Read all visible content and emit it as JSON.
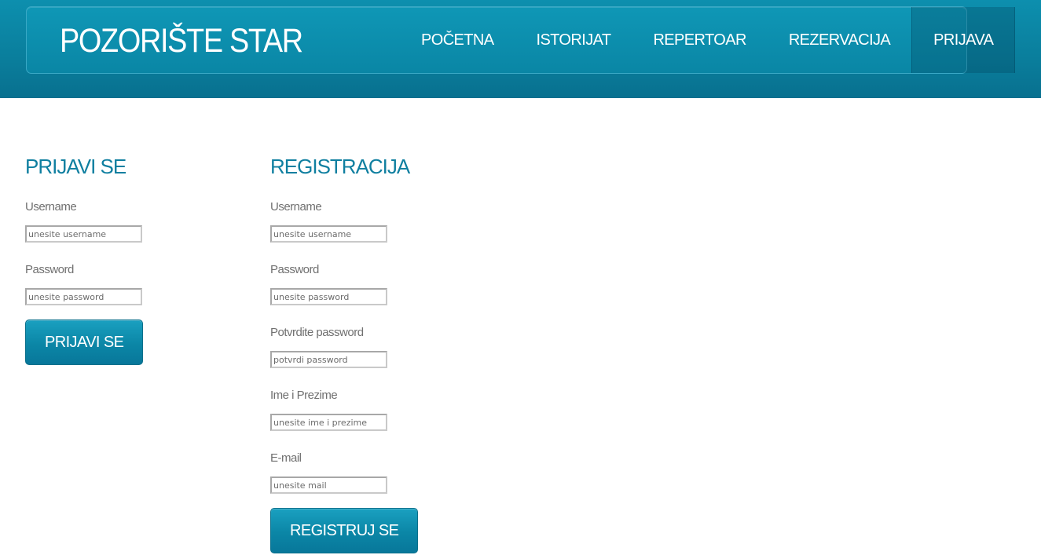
{
  "header": {
    "brand": "POZORIŠTE STAR",
    "menu": [
      {
        "label": "POČETNA"
      },
      {
        "label": "ISTORIJAT"
      },
      {
        "label": "REPERTOAR"
      },
      {
        "label": "REZERVACIJA"
      },
      {
        "label": "PRIJAVA"
      }
    ],
    "active_item": "PRIJAVA"
  },
  "login": {
    "title": "PRIJAVI SE",
    "username_label": "Username",
    "username_placeholder": "unesite username",
    "password_label": "Password",
    "password_placeholder": "unesite password",
    "button_label": "PRIJAVI SE"
  },
  "register": {
    "title": "REGISTRACIJA",
    "username_label": "Username",
    "username_placeholder": "unesite username",
    "password_label": "Password",
    "password_placeholder": "unesite password",
    "confirm_label": "Potvrdite password",
    "confirm_placeholder": "potvrdi password",
    "name_label": "Ime i Prezime",
    "name_placeholder": "unesite ime i prezime",
    "email_label": "E-mail",
    "email_placeholder": "unesite mail",
    "button_label": "REGISTRUJ SE"
  },
  "colors": {
    "header_bg": "#0a86a5",
    "accent_text": "#0f7fa0",
    "label_text": "#707070"
  }
}
